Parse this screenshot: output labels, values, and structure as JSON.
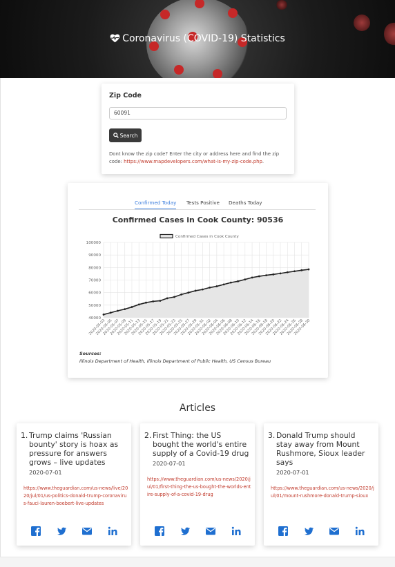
{
  "header": {
    "title": "Coronavirus (COVID-19) Statistics",
    "icon": "heart-pulse-icon"
  },
  "zip": {
    "label": "Zip Code",
    "value": "60091",
    "search_label": "Search",
    "help_text": "Dont know the zip code? Enter the city or address here and find the zip code: ",
    "help_link": "https://www.mapdevelopers.com/what-is-my-zip-code.php",
    "help_end": "."
  },
  "tabs": [
    {
      "label": "Confirmed Today",
      "active": true
    },
    {
      "label": "Tests Positive",
      "active": false
    },
    {
      "label": "Deaths Today",
      "active": false
    }
  ],
  "chart_data": {
    "type": "area",
    "title": "Confirmed Cases in Cook County: 90536",
    "legend": "Confirmed Cases in Cook County",
    "legend_position": "top",
    "grid": true,
    "ylim": [
      40000,
      100000
    ],
    "yticks": [
      40000,
      50000,
      60000,
      70000,
      80000,
      90000,
      100000
    ],
    "x": [
      "2020-05-03",
      "2020-05-05",
      "2020-05-07",
      "2020-05-09",
      "2020-05-11",
      "2020-05-13",
      "2020-05-15",
      "2020-05-17",
      "2020-05-19",
      "2020-05-21",
      "2020-05-23",
      "2020-05-25",
      "2020-05-27",
      "2020-05-29",
      "2020-05-31",
      "2020-06-02",
      "2020-06-04",
      "2020-06-06",
      "2020-06-08",
      "2020-06-10",
      "2020-06-12",
      "2020-06-14",
      "2020-06-16",
      "2020-06-18",
      "2020-06-20",
      "2020-06-22",
      "2020-06-24",
      "2020-06-26",
      "2020-06-28",
      "2020-06-30"
    ],
    "values": [
      42500,
      44000,
      45500,
      46800,
      48500,
      50500,
      52000,
      53000,
      53500,
      55500,
      56500,
      58500,
      60000,
      61500,
      62500,
      64000,
      65000,
      66500,
      68000,
      69000,
      70500,
      72000,
      73000,
      73800,
      74500,
      75300,
      76200,
      77000,
      77800,
      78500
    ],
    "color": "#222222",
    "fill": "#e6e6e6"
  },
  "sources": {
    "label": "Sources:",
    "text": "Illinois Department of Health, Illinois Department of Public Health, US Census Bureau"
  },
  "articles_title": "Articles",
  "articles": [
    {
      "num": "1.",
      "title": "Trump claims 'Russian bounty' story is hoax as pressure for answers grows – live updates",
      "date": "2020-07-01",
      "url": "https://www.theguardian.com/us-news/live/2020/jul/01/us-politics-donald-trump-coronavirus-fauci-lauren-boebert-live-updates"
    },
    {
      "num": "2.",
      "title": "First Thing: the US bought the world's entire supply of a Covid-19 drug",
      "date": "2020-07-01",
      "url": "https://www.theguardian.com/us-news/2020/jul/01/first-thing-the-us-bought-the-worlds-entire-supply-of-a-covid-19-drug"
    },
    {
      "num": "3.",
      "title": "Donald Trump should stay away from Mount Rushmore, Sioux leader says",
      "date": "2020-07-01",
      "url": "https://www.theguardian.com/us-news/2020/jul/01/mount-rushmore-donald-trump-sioux"
    }
  ],
  "share_icons": [
    "facebook-icon",
    "twitter-icon",
    "email-icon",
    "linkedin-icon"
  ],
  "colors": {
    "link": "#c0392b",
    "share": "#1f6fd0",
    "accent": "#3b7ddd"
  }
}
